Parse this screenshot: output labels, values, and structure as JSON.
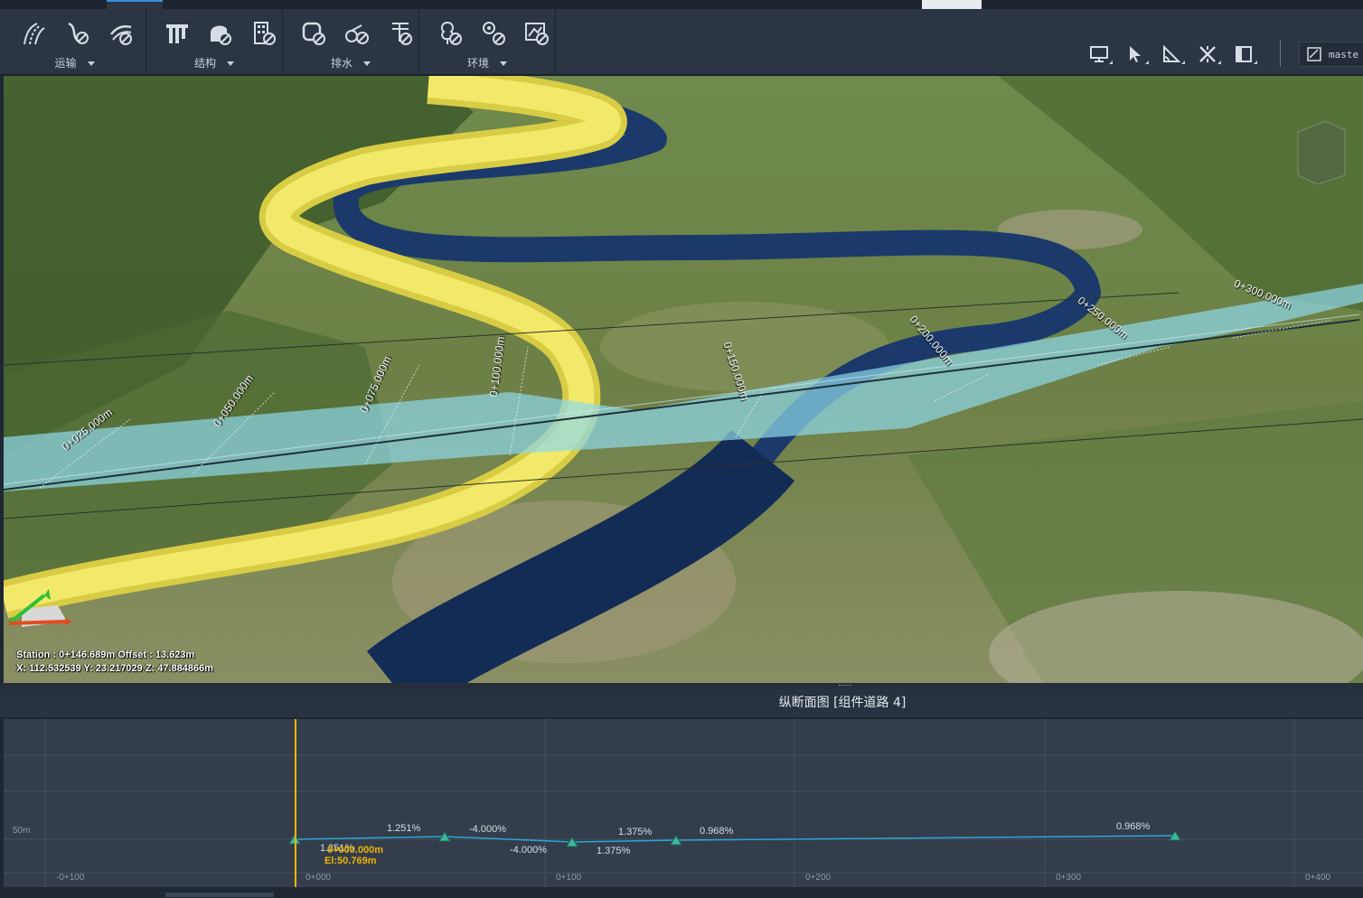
{
  "ribbon": {
    "groups": [
      {
        "label": "运输",
        "tools": [
          "road-alignment-icon",
          "road-curve-icon",
          "road-tool-icon"
        ]
      },
      {
        "label": "结构",
        "tools": [
          "bridge-icon",
          "tunnel-icon",
          "building-icon"
        ]
      },
      {
        "label": "排水",
        "tools": [
          "drainage-node-icon",
          "drainage-pipe-icon",
          "drainage-inlet-icon"
        ]
      },
      {
        "label": "环境",
        "tools": [
          "environment-tree-icon",
          "environment-terrain-icon",
          "environment-map-icon"
        ]
      }
    ],
    "right_tools": [
      "monitor-icon",
      "select-pointer-icon",
      "measure-angle-icon",
      "transform-icon",
      "panel-toggle-icon"
    ],
    "master_label": "maste"
  },
  "viewport": {
    "station_readout": "Station : 0+146.689m Offset : 13.623m",
    "coord_readout": "X: 112.532539 Y: 23.217029 Z: 47.884866m",
    "stations": [
      "0+025.000m",
      "0+050.000m",
      "0+075.000m",
      "0+100.000m",
      "0+150.000m",
      "0+200.000m",
      "0+250.000m",
      "0+300.000m"
    ]
  },
  "profile": {
    "title": "纵断面图 [组件道路 4]",
    "elevation_label": "50m",
    "x_ticks": [
      "-0+100",
      "0+000",
      "0+100",
      "0+200",
      "0+300",
      "0+400"
    ],
    "grade_labels": [
      "1.251%",
      "-4.000%",
      "1.375%",
      "0.968%",
      "1.251%",
      "-4.000%",
      "1.375%",
      "0.968%"
    ],
    "cursor_station": "0+000.000m",
    "cursor_elevation": "El:50.769m"
  },
  "colors": {
    "road_yellow": "#f2e96a",
    "river_blue": "#1b3a6b",
    "corridor_cyan": "#8fd8ea",
    "profile_line": "#2aa6d6",
    "pvi_marker": "#3db89a",
    "cursor": "#f0b400"
  }
}
